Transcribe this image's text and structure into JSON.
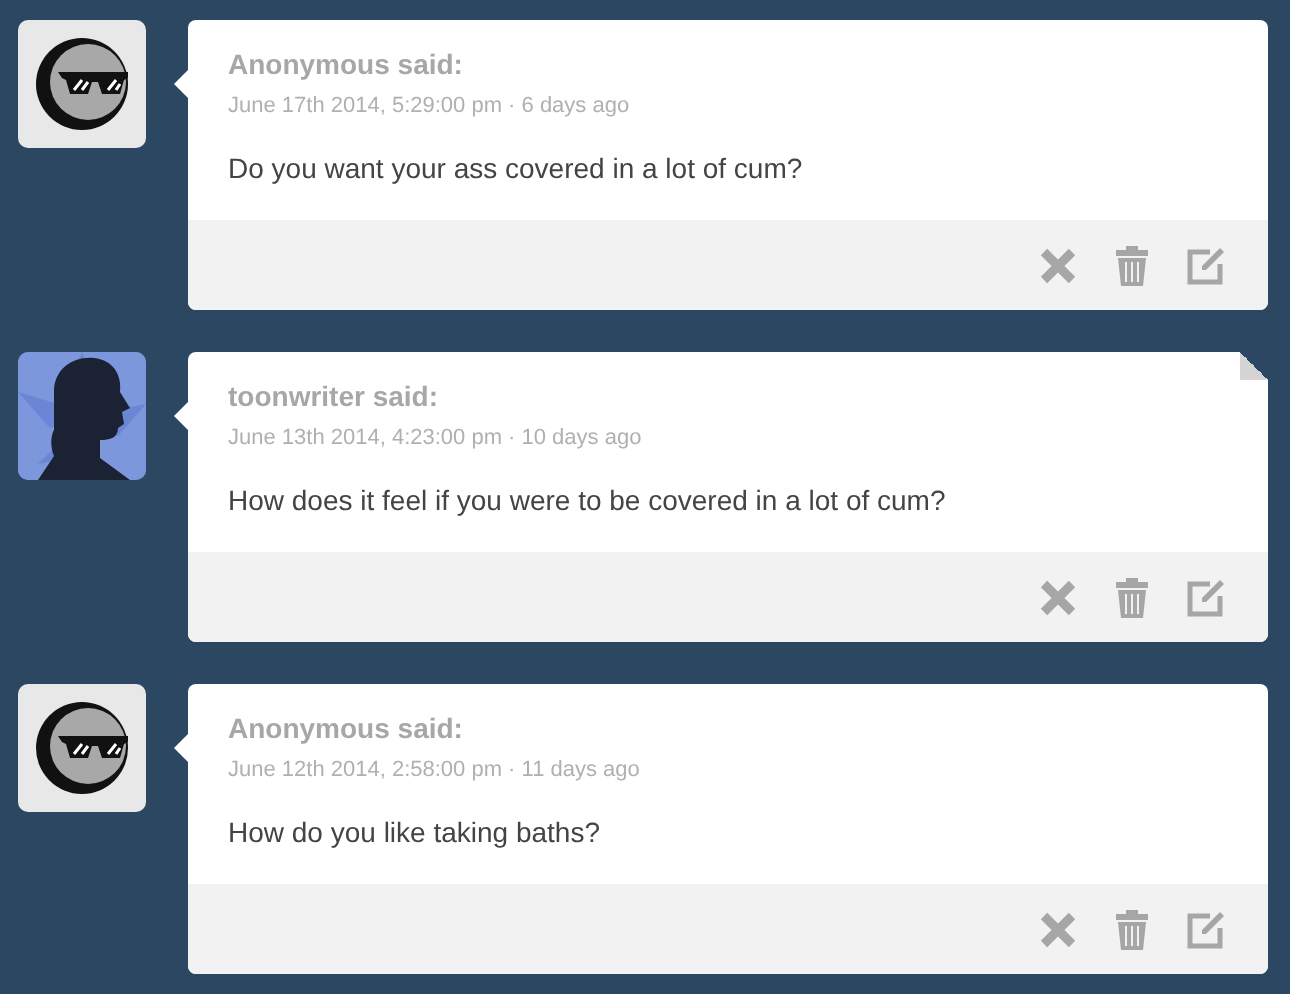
{
  "asks": [
    {
      "avatar": {
        "kind": "anonymous"
      },
      "author": "Anonymous said:",
      "date": "June 17th 2014, 5:29:00 pm · 6 days ago",
      "question": "Do you want your ass covered in a lot of cum?",
      "folded": false
    },
    {
      "avatar": {
        "kind": "silhouette"
      },
      "author": "toonwriter said:",
      "date": "June 13th 2014, 4:23:00 pm · 10 days ago",
      "question": "How does it feel if you were to be covered in a lot of cum?",
      "folded": true
    },
    {
      "avatar": {
        "kind": "anonymous"
      },
      "author": "Anonymous said:",
      "date": "June 12th 2014, 2:58:00 pm · 11 days ago",
      "question": "How do you like taking baths?",
      "folded": false
    }
  ]
}
